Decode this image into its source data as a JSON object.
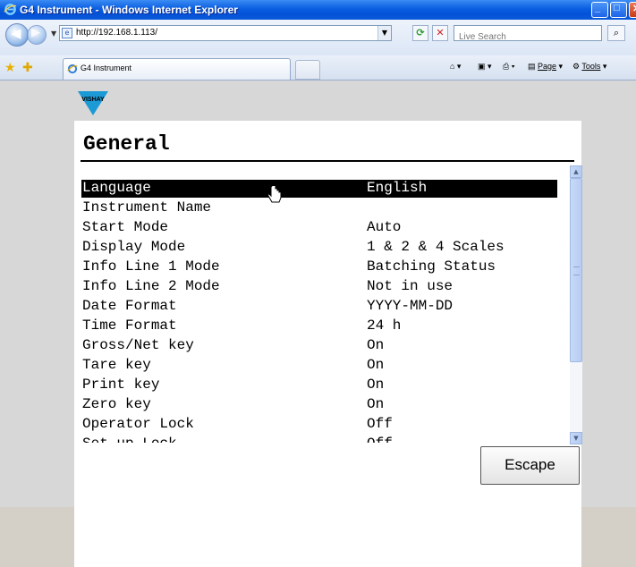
{
  "window": {
    "title": "G4 Instrument - Windows Internet Explorer"
  },
  "browser": {
    "url": "http://192.168.1.113/",
    "search_placeholder": "Live Search",
    "tab_title": "G4 Instrument",
    "cmd_page": "Page",
    "cmd_tools": "Tools"
  },
  "page": {
    "logo_text": "VISHAY",
    "title": "General",
    "settings": [
      {
        "label": "Language",
        "value": "English",
        "selected": true
      },
      {
        "label": "Instrument Name",
        "value": ""
      },
      {
        "label": "Start Mode",
        "value": "Auto"
      },
      {
        "label": "Display Mode",
        "value": "1 & 2 & 4 Scales"
      },
      {
        "label": "Info Line 1 Mode",
        "value": "Batching Status"
      },
      {
        "label": "Info Line 2 Mode",
        "value": "Not in use"
      },
      {
        "label": "Date Format",
        "value": "YYYY-MM-DD"
      },
      {
        "label": "Time Format",
        "value": "24 h"
      },
      {
        "label": "Gross/Net key",
        "value": "On"
      },
      {
        "label": "Tare key",
        "value": "On"
      },
      {
        "label": "Print key",
        "value": "On"
      },
      {
        "label": "Zero key",
        "value": "On"
      },
      {
        "label": "Operator Lock",
        "value": "Off"
      },
      {
        "label": "Set-up Lock",
        "value": "Off"
      }
    ],
    "escape_label": "Escape"
  },
  "colors": {
    "titlebar": "#0a5ee0",
    "selected_row_bg": "#000000",
    "page_bg": "#d7d7d7",
    "logo_blue": "#1b9ad6"
  }
}
